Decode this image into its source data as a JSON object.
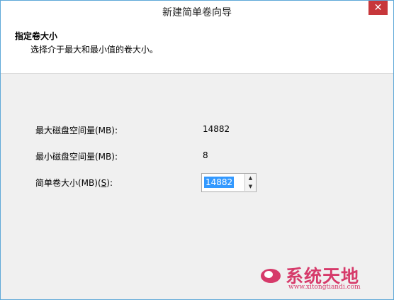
{
  "window": {
    "title": "新建简单卷向导",
    "close_icon": "✕"
  },
  "header": {
    "title": "指定卷大小",
    "subtitle": "选择介于最大和最小值的卷大小。"
  },
  "fields": {
    "max_label": "最大磁盘空间量(MB):",
    "max_value": "14882",
    "min_label": "最小磁盘空间量(MB):",
    "min_value": "8",
    "size_label_prefix": "简单卷大小(MB)(",
    "size_label_key": "S",
    "size_label_suffix": "):",
    "size_value": "14882"
  },
  "watermark": {
    "text": "系统天地",
    "url": "www.xitongtiandi.com",
    "color": "#d63a6a"
  }
}
